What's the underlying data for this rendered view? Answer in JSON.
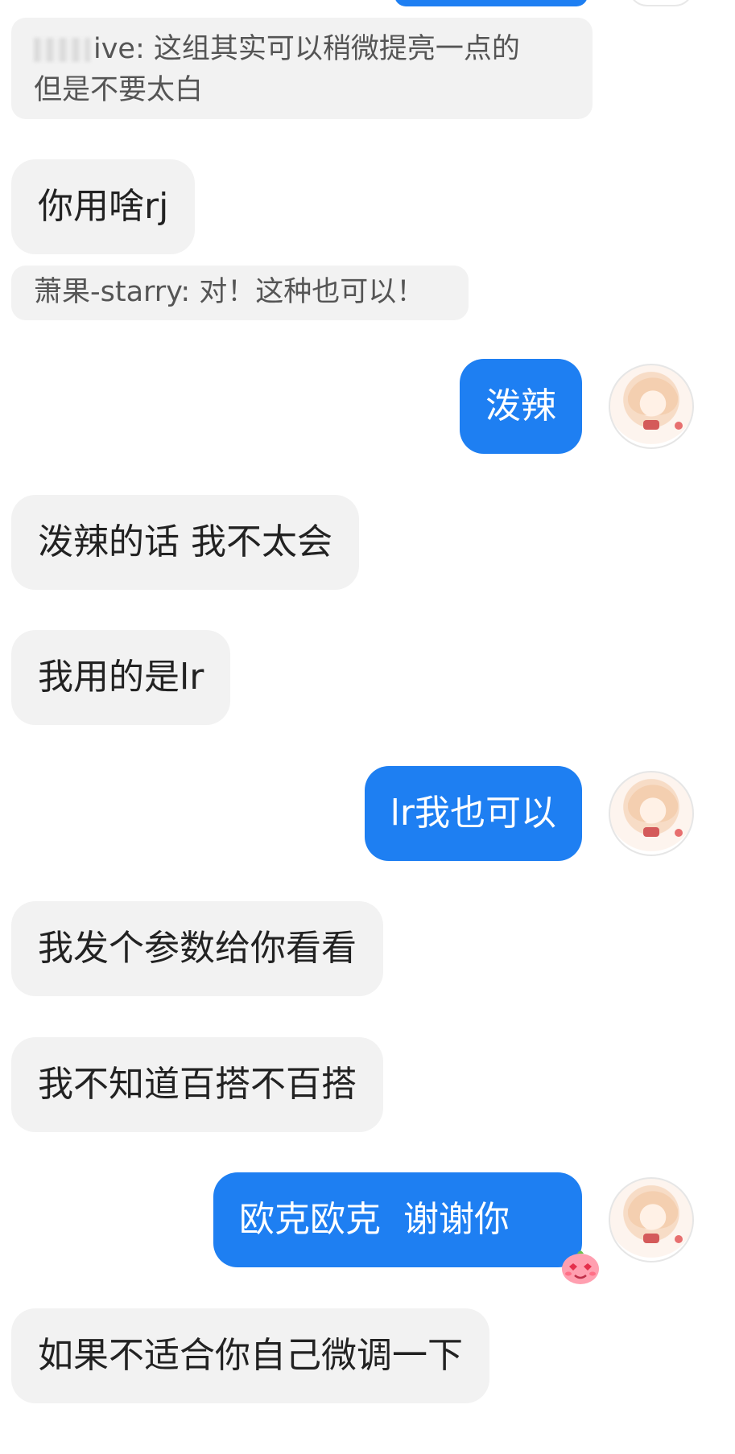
{
  "messages": [
    {
      "type": "quote",
      "name_redacted": true,
      "text_line1": "ive: 这组其实可以稍微提亮一点的",
      "text_line2": "但是不要太白"
    },
    {
      "type": "incoming",
      "text": "你用啥rj"
    },
    {
      "type": "quote",
      "text": "萧果-starry: 对！这种也可以！"
    },
    {
      "type": "outgoing",
      "text": "泼辣"
    },
    {
      "type": "incoming",
      "text": "泼辣的话 我不太会"
    },
    {
      "type": "incoming",
      "text": "我用的是lr"
    },
    {
      "type": "outgoing",
      "text": "lr我也可以"
    },
    {
      "type": "incoming",
      "text": "我发个参数给你看看"
    },
    {
      "type": "incoming",
      "text": "我不知道百搭不百搭"
    },
    {
      "type": "outgoing",
      "text": "欧克欧克  谢谢你",
      "emoji": "blushing-face-emoji"
    },
    {
      "type": "incoming",
      "text": "如果不适合你自己微调一下"
    }
  ],
  "colors": {
    "outgoing_bubble": "#1e7ff2",
    "incoming_bubble": "#f2f2f2",
    "incoming_text": "#222222",
    "quote_text": "#555555"
  }
}
